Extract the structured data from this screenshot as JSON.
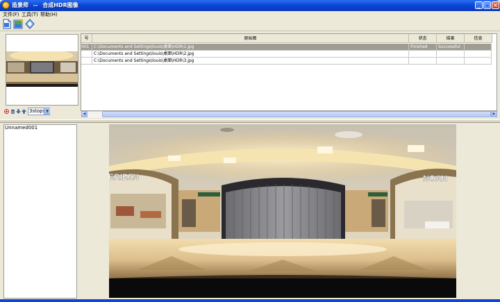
{
  "window": {
    "app_name": "造景师",
    "separator": "--",
    "subtitle": "合成HDR图像"
  },
  "menu": [
    {
      "label": "文件(F)"
    },
    {
      "label": "工具(T)"
    },
    {
      "label": "帮助(H)"
    }
  ],
  "toolbar": {
    "icons": [
      "file-icon",
      "edit-image-icon",
      "diamond-icon"
    ]
  },
  "stack": {
    "stops_value": "3stops",
    "icons": [
      "add-icon",
      "delete-icon",
      "move-down-icon",
      "move-up-icon"
    ]
  },
  "table": {
    "columns": [
      "号",
      "原始图",
      "状态",
      "结果",
      "信息"
    ],
    "rows": [
      {
        "num": "001",
        "path": "C:\\Documents and Settings\\louis\\桌面\\HDR\\1.jpg",
        "status": "Finished",
        "result": "Successful",
        "info": ""
      },
      {
        "num": "",
        "path": "C:\\Documents and Settings\\louis\\桌面\\HDR\\2.jpg",
        "status": "",
        "result": "",
        "info": ""
      },
      {
        "num": "",
        "path": "C:\\Documents and Settings\\louis\\桌面\\HDR\\3.jpg",
        "status": "",
        "result": "",
        "info": ""
      }
    ]
  },
  "layers": {
    "item": "Unnamed001"
  },
  "preview": {
    "signs": [
      "ERIEZN",
      "NOAH"
    ]
  },
  "colors": {
    "title_blue": "#0a46d8",
    "selected_row": "#a09c94",
    "panel_bg": "#ece9d8"
  }
}
